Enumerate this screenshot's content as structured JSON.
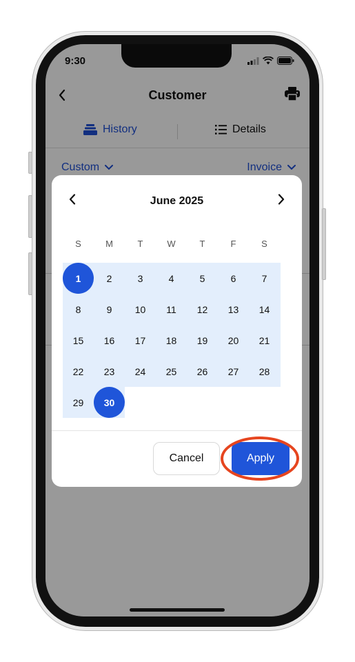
{
  "status_bar": {
    "time": "9:30"
  },
  "header": {
    "title": "Customer"
  },
  "tabs": [
    {
      "label": "History",
      "icon": "stack-icon"
    },
    {
      "label": "Details",
      "icon": "list-icon"
    }
  ],
  "filters": {
    "range_label": "Custom",
    "type_label": "Invoice"
  },
  "calendar": {
    "month_title": "June 2025",
    "weekdays": [
      "S",
      "M",
      "T",
      "W",
      "T",
      "F",
      "S"
    ],
    "days": [
      [
        "1",
        "2",
        "3",
        "4",
        "5",
        "6",
        "7"
      ],
      [
        "8",
        "9",
        "10",
        "11",
        "12",
        "13",
        "14"
      ],
      [
        "15",
        "16",
        "17",
        "18",
        "19",
        "20",
        "21"
      ],
      [
        "22",
        "23",
        "24",
        "25",
        "26",
        "27",
        "28"
      ],
      [
        "29",
        "30"
      ]
    ],
    "selected_start": "1",
    "selected_end": "30"
  },
  "actions": {
    "cancel_label": "Cancel",
    "apply_label": "Apply"
  },
  "colors": {
    "accent": "#1f55d9",
    "range_highlight": "#e3eefc",
    "annotation": "#e6451f"
  }
}
